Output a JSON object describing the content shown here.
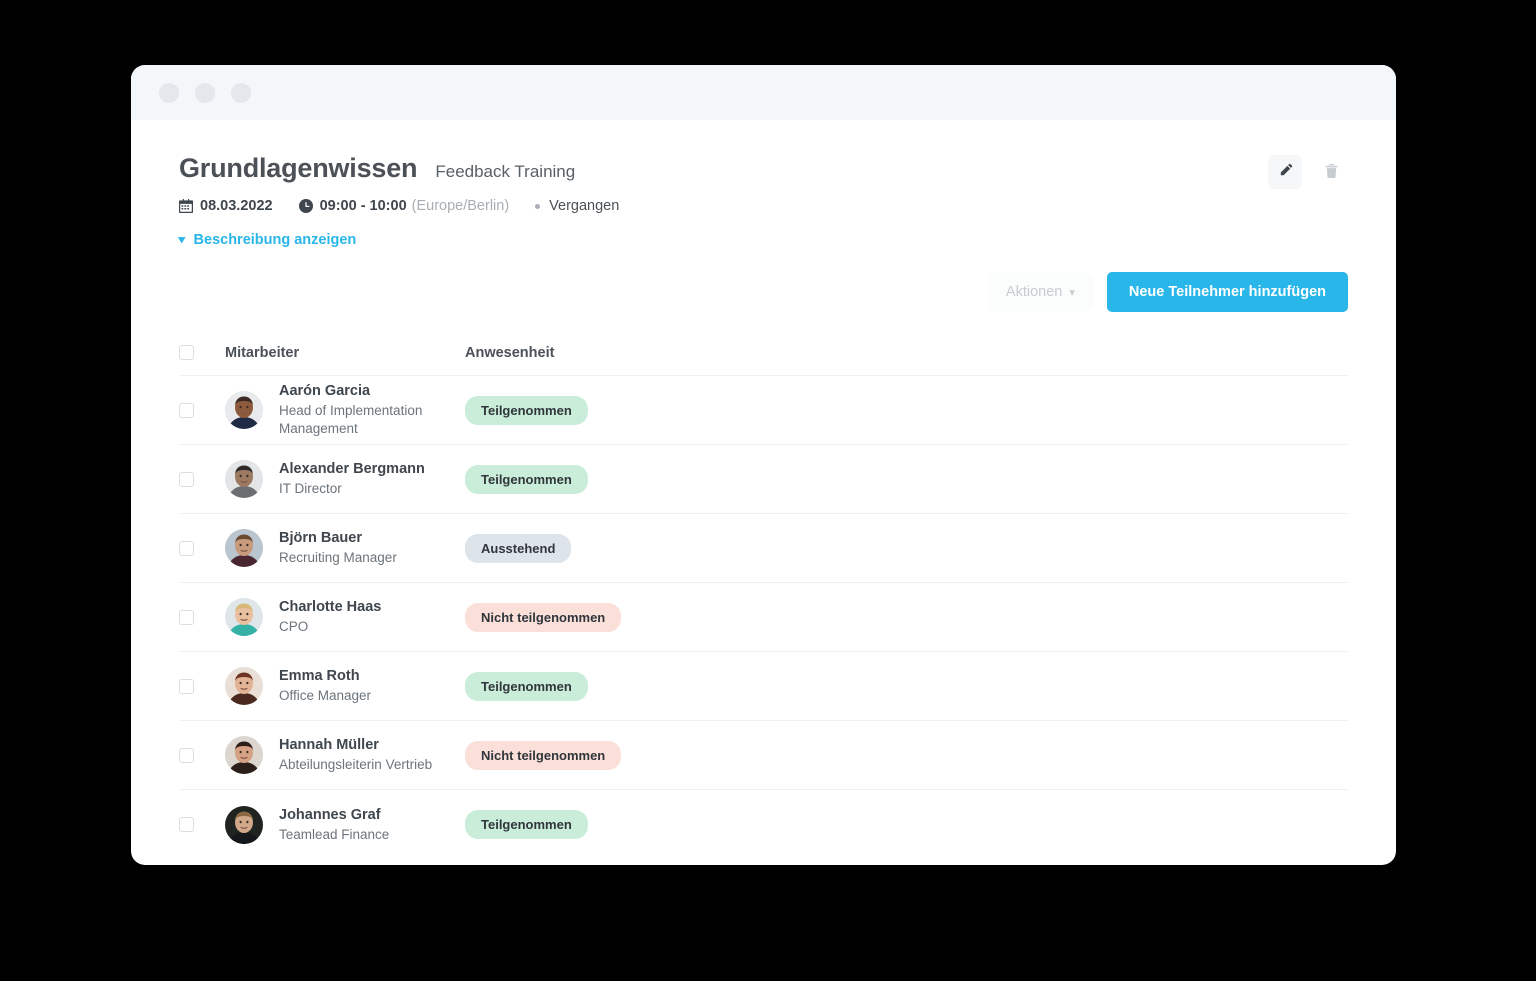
{
  "window": {
    "traffic_lights": [
      "minimize-dot",
      "maximize-dot",
      "close-dot"
    ]
  },
  "header": {
    "title": "Grundlagenwissen",
    "subtitle": "Feedback Training",
    "date": "08.03.2022",
    "time": "09:00 - 10:00",
    "timezone": "(Europe/Berlin)",
    "status": "Vergangen",
    "description_toggle": "Beschreibung anzeigen",
    "edit_label": "",
    "delete_label": ""
  },
  "toolbar": {
    "actions_label": "Aktionen",
    "actions_chevron": "˅",
    "add_participants_label": "Neue Teilnehmer hinzufügen"
  },
  "table": {
    "columns": {
      "select": "",
      "employee": "Mitarbeiter",
      "attendance": "Anwesenheit"
    },
    "rows": [
      {
        "name": "Aarón Garcia",
        "role": "Head of Implementation Management",
        "attendance": "Teilgenommen",
        "attendance_state": "attended",
        "avatar": "avatar-aaron-garcia"
      },
      {
        "name": "Alexander Bergmann",
        "role": "IT Director",
        "attendance": "Teilgenommen",
        "attendance_state": "attended",
        "avatar": "avatar-alexander-bergmann"
      },
      {
        "name": "Björn Bauer",
        "role": "Recruiting Manager",
        "attendance": "Ausstehend",
        "attendance_state": "pending",
        "avatar": "avatar-bjoern-bauer"
      },
      {
        "name": "Charlotte Haas",
        "role": "CPO",
        "attendance": "Nicht teilgenommen",
        "attendance_state": "absent",
        "avatar": "avatar-charlotte-haas"
      },
      {
        "name": "Emma Roth",
        "role": "Office Manager",
        "attendance": "Teilgenommen",
        "attendance_state": "attended",
        "avatar": "avatar-emma-roth"
      },
      {
        "name": "Hannah Müller",
        "role": "Abteilungsleiterin Vertrieb",
        "attendance": "Nicht teilgenommen",
        "attendance_state": "absent",
        "avatar": "avatar-hannah-mueller"
      },
      {
        "name": "Johannes Graf",
        "role": "Teamlead Finance",
        "attendance": "Teilgenommen",
        "attendance_state": "attended",
        "avatar": "avatar-johannes-graf"
      }
    ]
  },
  "colors": {
    "accent": "#29b6e8",
    "badge_attended_bg": "#c9edd8",
    "badge_pending_bg": "#dde4ea",
    "badge_absent_bg": "#fbdfd9",
    "title_text": "#4b5157",
    "muted_text": "#a8aeb4",
    "row_divider": "#eef2f5",
    "titlebar_bg": "#f4f7f9",
    "page_bg": "#000000"
  }
}
